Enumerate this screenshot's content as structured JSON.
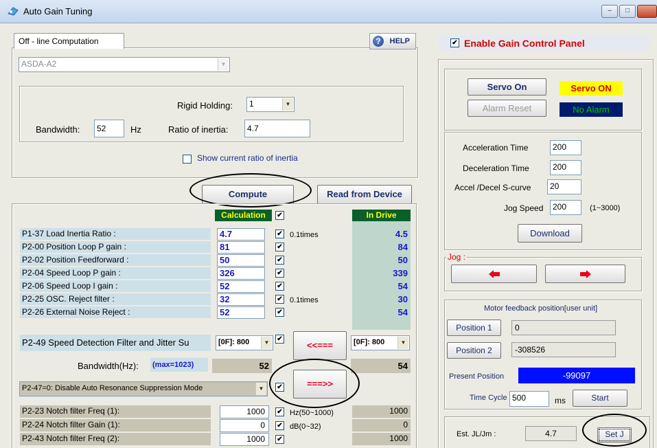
{
  "window": {
    "title": "Auto Gain Tuning",
    "controls": [
      "–",
      "□",
      ""
    ]
  },
  "offline": {
    "tab_label": "Off - line Computation",
    "help_label": "HELP",
    "model": "ASDA-A2",
    "rigid_holding_label": "Rigid Holding:",
    "rigid_holding_value": "1",
    "bandwidth_label": "Bandwidth:",
    "bandwidth_value": "52",
    "bandwidth_unit": "Hz",
    "ratio_label": "Ratio of inertia:",
    "ratio_value": "4.7",
    "show_ratio_label": "Show current ratio of inertia",
    "compute_label": "Compute",
    "read_label": "Read from Device"
  },
  "table": {
    "calc_header": "Calculation",
    "drive_header": "In Drive",
    "rows": [
      {
        "label": "P1-37 Load Inertia Ratio :",
        "calc": "4.7",
        "unit": "0.1times",
        "drive": "4.5"
      },
      {
        "label": "P2-00 Position Loop P gain :",
        "calc": "81",
        "unit": "",
        "drive": "84"
      },
      {
        "label": "P2-02 Position Feedforward :",
        "calc": "50",
        "unit": "",
        "drive": "50"
      },
      {
        "label": "P2-04 Speed Loop P gain :",
        "calc": "326",
        "unit": "",
        "drive": "339"
      },
      {
        "label": "P2-06 Speed Loop I gain :",
        "calc": "52",
        "unit": "",
        "drive": "54"
      },
      {
        "label": "P2-25 OSC. Reject filter :",
        "calc": "32",
        "unit": "0.1times",
        "drive": "30"
      },
      {
        "label": "P2-26 External Noise Reject :",
        "calc": "52",
        "unit": "",
        "drive": "54"
      }
    ],
    "p249_label": "P2-49 Speed Detection Filter and Jitter Su",
    "p249_calc": "[0F]: 800",
    "p249_drive": "[0F]: 800",
    "read_arrow": "<<===",
    "write_arrow": "===>>",
    "bw_label": "Bandwidth(Hz):",
    "bw_max": "(max=1023)",
    "bw_calc": "52",
    "bw_drive": "54",
    "p247_option": "P2-47=0: Disable Auto Resonance Suppression Mode",
    "notch_rows": [
      {
        "label": "P2-23 Notch filter Freq (1):",
        "calc": "1000",
        "unit": "Hz(50~1000)",
        "drive": "1000"
      },
      {
        "label": "P2-24 Notch filter Gain (1):",
        "calc": "0",
        "unit": "dB(0~32)",
        "drive": "0"
      },
      {
        "label": "P2-43 Notch filter Freq (2):",
        "calc": "1000",
        "unit": "",
        "drive": "1000"
      }
    ]
  },
  "right": {
    "enable_label": "Enable Gain Control Panel",
    "servo_on_label": "Servo On",
    "servo_status": "Servo ON",
    "alarm_reset_label": "Alarm Reset",
    "alarm_status": "No Alarm",
    "accel_label": "Acceleration Time",
    "accel_value": "200",
    "decel_label": "Deceleration Time",
    "decel_value": "200",
    "scurve_label": "Accel /Decel S-curve",
    "scurve_value": "20",
    "jog_speed_label": "Jog Speed",
    "jog_speed_value": "200",
    "jog_speed_range": "(1~3000)",
    "download_label": "Download",
    "jog_group_label": "Jog :",
    "motor_feedback_label": "Motor feedback position[user unit]",
    "position1_label": "Position 1",
    "position1_value": "0",
    "position2_label": "Position 2",
    "position2_value": "-308526",
    "present_label": "Present Position",
    "present_value": "-99097",
    "time_cycle_label": "Time Cycle",
    "time_cycle_value": "500",
    "time_cycle_unit": "ms",
    "start_label": "Start",
    "est_label": "Est. JL/Jm :",
    "est_value": "4.7",
    "setj_label": "Set J"
  },
  "colors": {
    "servo_on_bg": "#ffff00",
    "servo_on_fg": "#d40000",
    "no_alarm_bg": "#001a6e",
    "no_alarm_fg": "#00c800",
    "present_bg": "#0010ff",
    "header_bg": "#0a5f2a",
    "header_fg": "#ffff00"
  }
}
